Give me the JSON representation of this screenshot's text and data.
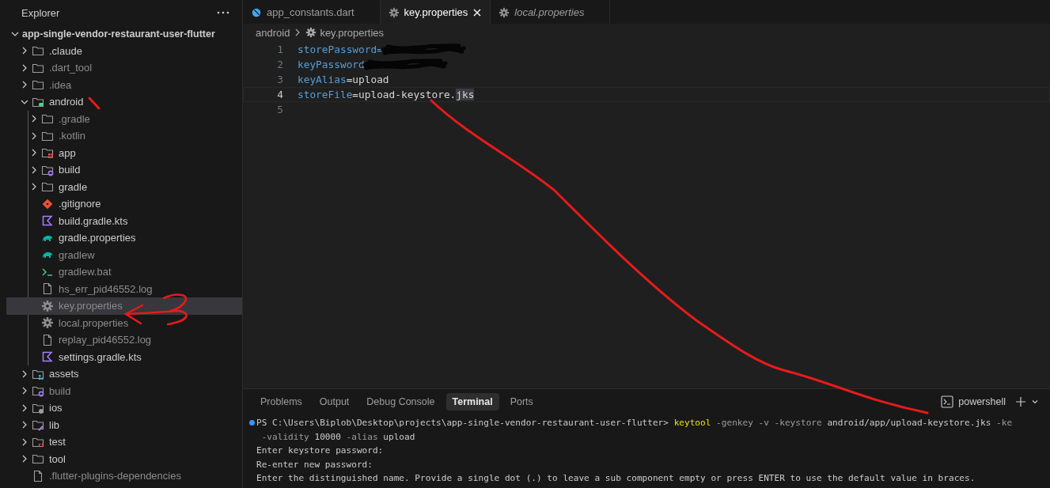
{
  "sidebar": {
    "title": "Explorer",
    "tree": [
      {
        "label": "app-single-vendor-restaurant-user-flutter",
        "kind": "root",
        "expanded": true,
        "selected": false,
        "ignored": false,
        "children": [
          {
            "label": ".claude",
            "kind": "folder",
            "expanded": false,
            "selected": false,
            "ignored": false
          },
          {
            "label": ".dart_tool",
            "kind": "folder",
            "expanded": false,
            "selected": false,
            "ignored": true
          },
          {
            "label": ".idea",
            "kind": "folder",
            "expanded": false,
            "selected": false,
            "ignored": true
          },
          {
            "label": "android",
            "kind": "android-folder",
            "expanded": true,
            "selected": false,
            "ignored": false,
            "children": [
              {
                "label": ".gradle",
                "kind": "folder",
                "expanded": false,
                "selected": false,
                "ignored": true
              },
              {
                "label": ".kotlin",
                "kind": "folder",
                "expanded": false,
                "selected": false,
                "ignored": true
              },
              {
                "label": "app",
                "kind": "app-folder",
                "expanded": false,
                "selected": false,
                "ignored": false
              },
              {
                "label": "build",
                "kind": "build-folder",
                "expanded": false,
                "selected": false,
                "ignored": false
              },
              {
                "label": "gradle",
                "kind": "folder",
                "expanded": false,
                "selected": false,
                "ignored": false
              },
              {
                "label": ".gitignore",
                "kind": "git-file",
                "selected": false,
                "ignored": false
              },
              {
                "label": "build.gradle.kts",
                "kind": "kotlin-file",
                "selected": false,
                "ignored": false
              },
              {
                "label": "gradle.properties",
                "kind": "gradle-file",
                "selected": false,
                "ignored": false
              },
              {
                "label": "gradlew",
                "kind": "gradle-file",
                "selected": false,
                "ignored": true
              },
              {
                "label": "gradlew.bat",
                "kind": "script-file",
                "selected": false,
                "ignored": true
              },
              {
                "label": "hs_err_pid46552.log",
                "kind": "file",
                "selected": false,
                "ignored": true
              },
              {
                "label": "key.properties",
                "kind": "settings-file",
                "selected": true,
                "ignored": true
              },
              {
                "label": "local.properties",
                "kind": "settings-file",
                "selected": false,
                "ignored": true
              },
              {
                "label": "replay_pid46552.log",
                "kind": "file",
                "selected": false,
                "ignored": true
              },
              {
                "label": "settings.gradle.kts",
                "kind": "kotlin-file",
                "selected": false,
                "ignored": false
              }
            ]
          },
          {
            "label": "assets",
            "kind": "assets-folder",
            "expanded": false,
            "selected": false,
            "ignored": false
          },
          {
            "label": "build",
            "kind": "build-folder",
            "expanded": false,
            "selected": false,
            "ignored": true
          },
          {
            "label": "ios",
            "kind": "ios-folder",
            "expanded": false,
            "selected": false,
            "ignored": false
          },
          {
            "label": "lib",
            "kind": "lib-folder",
            "expanded": false,
            "selected": false,
            "ignored": false
          },
          {
            "label": "test",
            "kind": "test-folder",
            "expanded": false,
            "selected": false,
            "ignored": false
          },
          {
            "label": "tool",
            "kind": "folder",
            "expanded": false,
            "selected": false,
            "ignored": false
          },
          {
            "label": ".flutter-plugins-dependencies",
            "kind": "file",
            "selected": false,
            "ignored": true
          }
        ]
      }
    ]
  },
  "editor": {
    "tabs": [
      {
        "label": "app_constants.dart",
        "kind": "dart-file",
        "selected": false,
        "preview": false
      },
      {
        "label": "key.properties",
        "kind": "settings-file",
        "selected": true,
        "preview": false
      },
      {
        "label": "local.properties",
        "kind": "settings-file",
        "selected": false,
        "preview": true
      }
    ],
    "breadcrumb": {
      "folder": "android",
      "file": "key.properties"
    },
    "lines": [
      {
        "number": "1",
        "current": false,
        "segments": [
          {
            "kind": "key",
            "text": "storePassword="
          },
          {
            "kind": "redacted"
          }
        ]
      },
      {
        "number": "2",
        "current": false,
        "segments": [
          {
            "kind": "key",
            "text": "keyPassword"
          },
          {
            "kind": "redacted"
          }
        ]
      },
      {
        "number": "3",
        "current": false,
        "segments": [
          {
            "kind": "key",
            "text": "keyAlias"
          },
          {
            "kind": "plain",
            "text": "=upload"
          }
        ]
      },
      {
        "number": "4",
        "current": true,
        "segments": [
          {
            "kind": "key",
            "text": "storeFile"
          },
          {
            "kind": "plain",
            "text": "=upload-keystore."
          },
          {
            "kind": "highlight",
            "text": "jks"
          }
        ]
      },
      {
        "number": "5",
        "current": false
      }
    ]
  },
  "panel": {
    "tabs": [
      {
        "label": "Problems",
        "selected": false
      },
      {
        "label": "Output",
        "selected": false
      },
      {
        "label": "Debug Console",
        "selected": false
      },
      {
        "label": "Terminal",
        "selected": true
      },
      {
        "label": "Ports",
        "selected": false
      }
    ],
    "shell": "powershell",
    "terminal": [
      {
        "kind": "prompt",
        "segments": [
          {
            "kind": "plain",
            "text": "PS C:\\Users\\Biplob\\Desktop\\projects\\app-single-vendor-restaurant-user-flutter> "
          },
          {
            "kind": "command",
            "text": "keytool"
          },
          {
            "kind": "flag",
            "text": " -genkey -v -keystore "
          },
          {
            "kind": "plain",
            "text": "android/app/upload-keystore.jks"
          },
          {
            "kind": "flag",
            "text": " -ke"
          }
        ]
      },
      {
        "kind": "output",
        "segments": [
          {
            "kind": "flag",
            "text": " -validity "
          },
          {
            "kind": "plain",
            "text": "10000"
          },
          {
            "kind": "flag",
            "text": " -alias "
          },
          {
            "kind": "plain",
            "text": "upload"
          }
        ]
      },
      {
        "kind": "output",
        "segments": [
          {
            "kind": "plain",
            "text": "Enter keystore password:"
          }
        ]
      },
      {
        "kind": "output",
        "segments": [
          {
            "kind": "plain",
            "text": "Re-enter new password:"
          }
        ]
      },
      {
        "kind": "output",
        "segments": [
          {
            "kind": "plain",
            "text": "Enter the distinguished name. Provide a single dot (.) to leave a sub component empty or press ENTER to use the default value in braces."
          }
        ]
      }
    ]
  }
}
